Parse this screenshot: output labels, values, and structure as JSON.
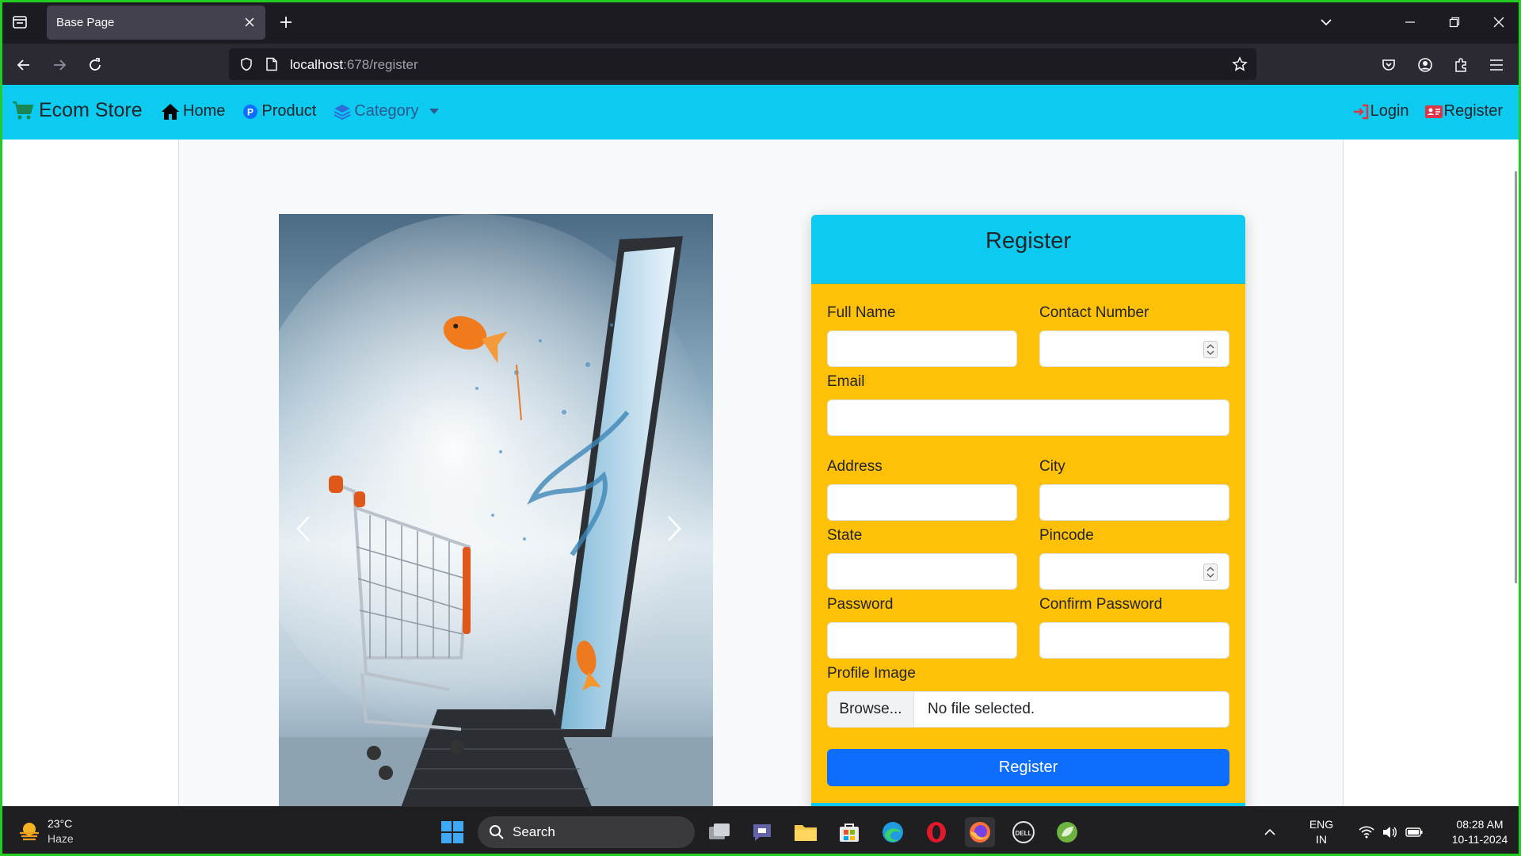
{
  "browser": {
    "tab_title": "Base Page",
    "url_host": "localhost",
    "url_rest": ":678/register"
  },
  "site": {
    "brand": "Ecom Store",
    "nav": {
      "home": "Home",
      "product": "Product",
      "category": "Category",
      "login": "Login",
      "register": "Register"
    }
  },
  "form": {
    "title": "Register",
    "fields": {
      "full_name": "Full Name",
      "contact": "Contact Number",
      "email": "Email",
      "address": "Address",
      "city": "City",
      "state": "State",
      "pincode": "Pincode",
      "password": "Password",
      "confirm_password": "Confirm Password",
      "profile_image": "Profile Image"
    },
    "browse_label": "Browse...",
    "no_file": "No file selected.",
    "submit": "Register"
  },
  "taskbar": {
    "temp": "23°C",
    "weather": "Haze",
    "search": "Search",
    "lang": "ENG",
    "region": "IN",
    "time": "08:28 AM",
    "date": "10-11-2024"
  },
  "colors": {
    "navbar": "#0dcaf0",
    "card_body": "#ffc107",
    "primary_button": "#0d6efd"
  }
}
